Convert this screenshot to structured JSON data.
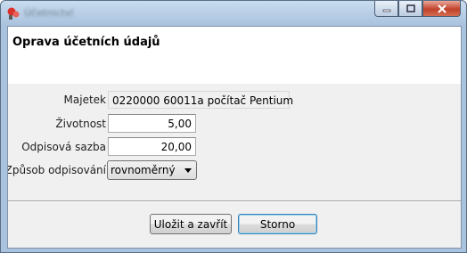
{
  "window": {
    "title": "Účetnictví",
    "buttons": {
      "minimize": "minimize",
      "maximize": "maximize",
      "close": "close"
    }
  },
  "dialog": {
    "title": "Oprava účetních údajů"
  },
  "form": {
    "asset": {
      "label": "Majetek",
      "value": "0220000 60011a počítač Pentium"
    },
    "lifetime": {
      "label": "Životnost",
      "value": "5,00"
    },
    "rate": {
      "label": "Odpisová sazba",
      "value": "20,00"
    },
    "method": {
      "label": "Způsob odpisování",
      "value": "rovnoměrný"
    }
  },
  "actions": {
    "save": "Uložit a zavřít",
    "cancel": "Storno"
  },
  "colors": {
    "titlebar": "#b9cfe6",
    "close_button": "#c2422b",
    "default_button_border": "#3c7fb1"
  }
}
